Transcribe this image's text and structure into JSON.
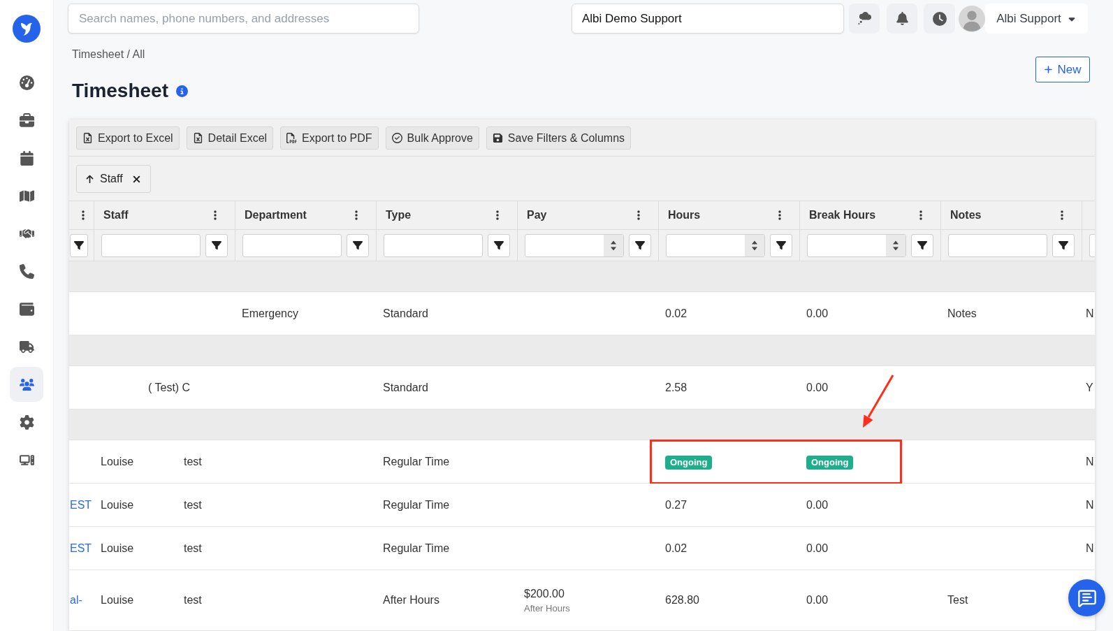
{
  "sidebar": {
    "items": [
      {
        "selected": false
      },
      {
        "selected": false
      },
      {
        "selected": false
      },
      {
        "selected": false
      },
      {
        "selected": false
      },
      {
        "selected": false
      },
      {
        "selected": false
      },
      {
        "selected": false
      },
      {
        "selected": true
      },
      {
        "selected": false
      },
      {
        "selected": false
      }
    ]
  },
  "top_bar": {
    "search": {
      "placeholder": "Search names, phone numbers, and addresses"
    },
    "organization": {
      "value": "Albi Demo Support"
    },
    "user": {
      "name": "Albi Support"
    }
  },
  "breadcrumb": "Timesheet / All",
  "page": {
    "title": "Timesheet",
    "new_button": "New"
  },
  "toolbar": {
    "buttons": [
      "Export to Excel",
      "Detail Excel",
      "Export to PDF",
      "Bulk Approve",
      "Save Filters & Columns"
    ]
  },
  "group_by": {
    "label": "Staff",
    "ascending": true
  },
  "table": {
    "columns": [
      {
        "label": "Staff",
        "kind": "text"
      },
      {
        "label": "Department",
        "kind": "text"
      },
      {
        "label": "Type",
        "kind": "text"
      },
      {
        "label": "Pay",
        "kind": "number"
      },
      {
        "label": "Hours",
        "kind": "number"
      },
      {
        "label": "Break Hours",
        "kind": "number"
      },
      {
        "label": "Notes",
        "kind": "text"
      }
    ],
    "rows": [
      {
        "kind": "group"
      },
      {
        "kind": "entry",
        "highlighted": false,
        "department": "Emergency",
        "type": "Standard",
        "hours": "0.02",
        "break_hours": "0.00",
        "notes": "Notes",
        "column_9": "N"
      },
      {
        "kind": "group"
      },
      {
        "kind": "entry",
        "highlighted": false,
        "staff": [
          "( Test) C"
        ],
        "type": "Standard",
        "hours": "2.58",
        "break_hours": "0.00",
        "column_9": "Y"
      },
      {
        "kind": "group"
      },
      {
        "kind": "entry",
        "highlighted": true,
        "staff": [
          "Louise",
          "test"
        ],
        "type": "Regular Time",
        "hours_status": "Ongoing",
        "break_status": "Ongoing",
        "column_9": "N"
      },
      {
        "kind": "entry",
        "highlighted": false,
        "column_1": "EST",
        "staff": [
          "Louise",
          "test"
        ],
        "type": "Regular Time",
        "hours": "0.27",
        "break_hours": "0.00",
        "column_9": "N"
      },
      {
        "kind": "entry",
        "highlighted": false,
        "column_1": "EST",
        "staff": [
          "Louise",
          "test"
        ],
        "type": "Regular Time",
        "hours": "0.02",
        "break_hours": "0.00",
        "column_9": "N"
      },
      {
        "kind": "entry",
        "highlighted": false,
        "column_1": "al-",
        "staff": [
          "Louise",
          "test"
        ],
        "type": "After Hours",
        "pay": "$200.00",
        "pay_note": "After Hours",
        "hours": "628.80",
        "break_hours": "0.00",
        "notes": "Test"
      }
    ]
  }
}
